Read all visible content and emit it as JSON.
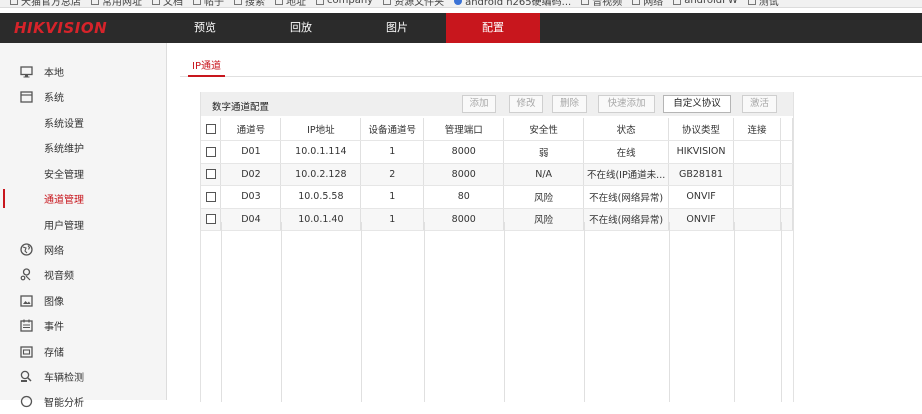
{
  "bookmarks": [
    "天猫官方总店",
    "常用网址",
    "文档",
    "帖子",
    "搜索",
    "地址",
    "company",
    "资源文件夹",
    "android h265硬编码...",
    "音视频",
    "网络",
    "androidFW",
    "测试"
  ],
  "brand": {
    "logo": "HIKVISION",
    "accent": "#c8161d",
    "logo_color": "#d6232a"
  },
  "topnav": {
    "tabs": [
      {
        "label": "预览",
        "active": false
      },
      {
        "label": "回放",
        "active": false
      },
      {
        "label": "图片",
        "active": false
      },
      {
        "label": "配置",
        "active": true
      }
    ]
  },
  "sidebar": {
    "items": [
      {
        "label": "本地",
        "icon": "monitor-icon",
        "active": false
      },
      {
        "label": "系统",
        "icon": "system-icon",
        "active": false
      },
      {
        "label": "系统设置",
        "icon": "",
        "active": false
      },
      {
        "label": "系统维护",
        "icon": "",
        "active": false
      },
      {
        "label": "安全管理",
        "icon": "",
        "active": false
      },
      {
        "label": "通道管理",
        "icon": "",
        "active": true
      },
      {
        "label": "用户管理",
        "icon": "",
        "active": false
      },
      {
        "label": "网络",
        "icon": "globe-icon",
        "active": false
      },
      {
        "label": "视音频",
        "icon": "audio-video-icon",
        "active": false
      },
      {
        "label": "图像",
        "icon": "image-icon",
        "active": false
      },
      {
        "label": "事件",
        "icon": "calendar-icon",
        "active": false
      },
      {
        "label": "存储",
        "icon": "storage-icon",
        "active": false
      },
      {
        "label": "车辆检测",
        "icon": "vehicle-detect-icon",
        "active": false
      },
      {
        "label": "智能分析",
        "icon": "smart-analysis-icon",
        "active": false
      }
    ]
  },
  "content": {
    "subtab": "IP通道",
    "panel_title": "数字通道配置",
    "buttons": [
      {
        "label": "添加",
        "enabled": false
      },
      {
        "label": "修改",
        "enabled": false
      },
      {
        "label": "删除",
        "enabled": false
      },
      {
        "label": "快速添加",
        "enabled": false
      },
      {
        "label": "自定义协议",
        "enabled": true
      },
      {
        "label": "激活",
        "enabled": false
      }
    ],
    "columns": [
      "通道号",
      "IP地址",
      "设备通道号",
      "管理端口",
      "安全性",
      "状态",
      "协议类型",
      "连接"
    ],
    "rows": [
      [
        "D01",
        "10.0.1.114",
        "1",
        "8000",
        "弱",
        "在线",
        "HIKVISION",
        ""
      ],
      [
        "D02",
        "10.0.2.128",
        "2",
        "8000",
        "N/A",
        "不在线(IP通道未...",
        "GB28181",
        ""
      ],
      [
        "D03",
        "10.0.5.58",
        "1",
        "80",
        "风险",
        "不在线(网络异常)",
        "ONVIF",
        ""
      ],
      [
        "D04",
        "10.0.1.40",
        "1",
        "8000",
        "风险",
        "不在线(网络异常)",
        "ONVIF",
        ""
      ]
    ]
  }
}
